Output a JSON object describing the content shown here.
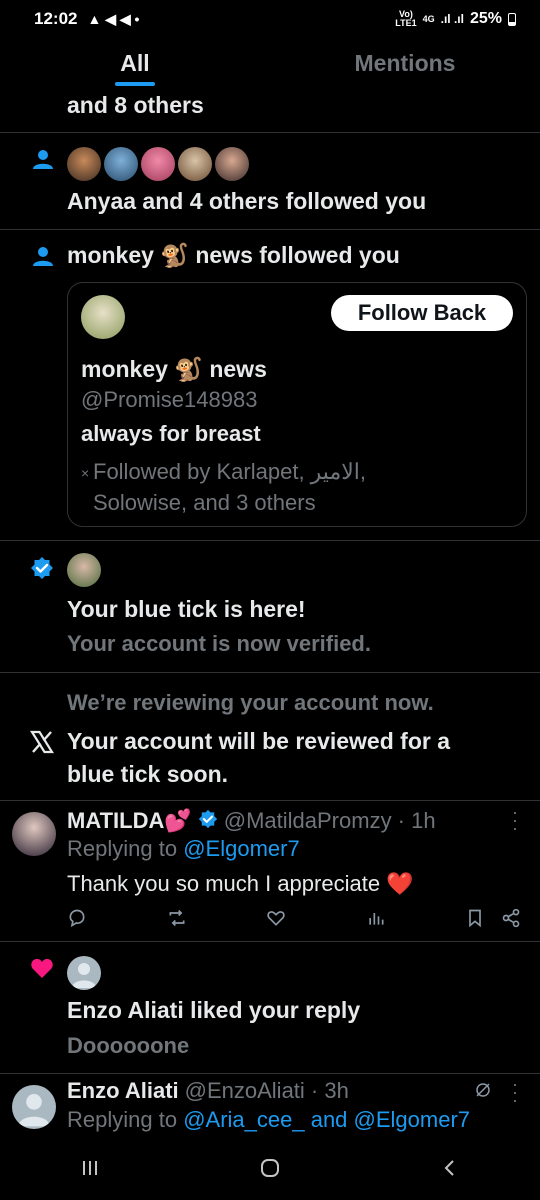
{
  "status_bar": {
    "time": "12:02",
    "battery": "25%",
    "network": "4G"
  },
  "tabs": [
    {
      "label": "All"
    },
    {
      "label": "Mentions"
    }
  ],
  "notifications": {
    "n0": {
      "text": "and 8 others"
    },
    "n1": {
      "text": "Anyaa and 4 others followed you"
    },
    "n2": {
      "text": "monkey 🐒 news followed you",
      "card": {
        "follow_back": "Follow Back",
        "name": "monkey 🐒 news",
        "handle": "@Promise148983",
        "bio": "always for breast",
        "followed_by_line1": "Followed by Karlapet, الامير,",
        "followed_by_line2": "Solowise, and 3 others"
      }
    },
    "n3": {
      "title": "Your blue tick is here!",
      "subtitle": "Your account is now verified."
    },
    "n4": {
      "subtitle": "We’re reviewing your account now.",
      "title_line1": "Your account will be reviewed for a",
      "title_line2": "blue tick soon."
    },
    "reply1": {
      "name": "MATILDA💕",
      "handle": "@MatildaPromzy · 1h",
      "replying_prefix": "Replying to",
      "replying_to": "@Elgomer7",
      "text": "Thank you so much I appreciate ❤️"
    },
    "n5": {
      "title": "Enzo Aliati liked your reply",
      "subtitle": "Doooooone"
    },
    "reply2": {
      "name": "Enzo Aliati",
      "handle": "@EnzoAliati · 3h",
      "replying_prefix": "Replying to",
      "replying_to": "@Aria_cee_ and @Elgomer7"
    }
  },
  "colors": {
    "accent": "#1d9bf0",
    "like": "#f91880",
    "background": "#000000"
  }
}
